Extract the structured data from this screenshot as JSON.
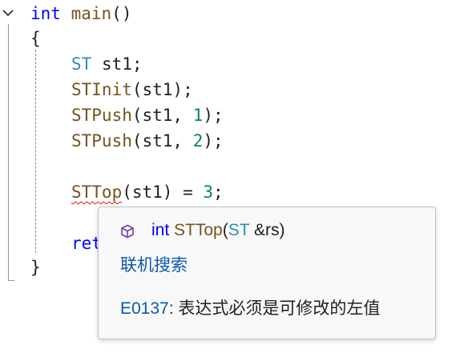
{
  "code": {
    "line1": {
      "kw": "int",
      "name": "main",
      "paren": "()"
    },
    "line2": {
      "brace": "{"
    },
    "line3": {
      "type": "ST",
      "rest": " st1;"
    },
    "line4": {
      "fn": "STInit",
      "rest": "(st1);"
    },
    "line5": {
      "fn": "STPush",
      "args": "(st1, ",
      "num": "1",
      "end": ");"
    },
    "line6": {
      "fn": "STPush",
      "args": "(st1, ",
      "num": "2",
      "end": ");"
    },
    "line8": {
      "fn": "STTop",
      "args": "(st1) = ",
      "num": "3",
      "end": ";"
    },
    "line10": {
      "partial": "ret"
    },
    "line11": {
      "brace": "}"
    }
  },
  "popup": {
    "icon": "cube-icon",
    "sig_kw": "int",
    "sig_fn": "STTop",
    "sig_open": "(",
    "sig_type": "ST",
    "sig_param": " &rs",
    "sig_close": ")",
    "online_search": "联机搜索",
    "error_code": "E0137",
    "error_message": ": 表达式必须是可修改的左值"
  },
  "colors": {
    "keyword": "#0000ff",
    "function": "#74531f",
    "type": "#2b91af",
    "number": "#098658",
    "link": "#0c5aa6",
    "squiggle": "#e51400"
  }
}
